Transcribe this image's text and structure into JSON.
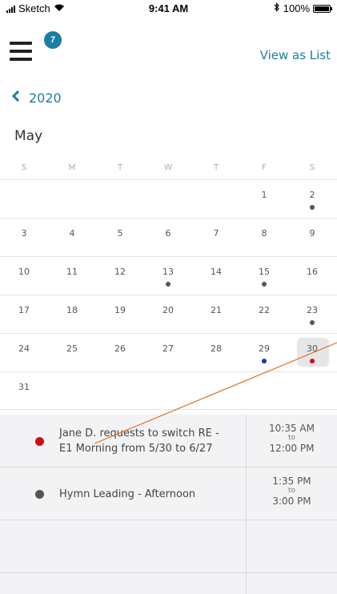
{
  "status_bar": {
    "carrier": "Sketch",
    "time": "9:41 AM",
    "battery": "100%",
    "battery_level": 1.0
  },
  "header": {
    "menu_badge": "7",
    "view_as_list": "View as List"
  },
  "calendar": {
    "year": "2020",
    "month": "May",
    "weekdays": [
      "S",
      "M",
      "T",
      "W",
      "T",
      "F",
      "S"
    ],
    "weeks": [
      [
        {
          "d": ""
        },
        {
          "d": ""
        },
        {
          "d": ""
        },
        {
          "d": ""
        },
        {
          "d": ""
        },
        {
          "d": "1"
        },
        {
          "d": "2",
          "dot": "#555555"
        }
      ],
      [
        {
          "d": "3"
        },
        {
          "d": "4"
        },
        {
          "d": "5"
        },
        {
          "d": "6"
        },
        {
          "d": "7"
        },
        {
          "d": "8"
        },
        {
          "d": "9"
        }
      ],
      [
        {
          "d": "10"
        },
        {
          "d": "11"
        },
        {
          "d": "12"
        },
        {
          "d": "13",
          "dot": "#555555"
        },
        {
          "d": "14"
        },
        {
          "d": "15",
          "dot": "#555555"
        },
        {
          "d": "16"
        }
      ],
      [
        {
          "d": "17"
        },
        {
          "d": "18"
        },
        {
          "d": "19"
        },
        {
          "d": "20"
        },
        {
          "d": "21"
        },
        {
          "d": "22"
        },
        {
          "d": "23",
          "dot": "#555555"
        }
      ],
      [
        {
          "d": "24"
        },
        {
          "d": "25"
        },
        {
          "d": "26"
        },
        {
          "d": "27"
        },
        {
          "d": "28"
        },
        {
          "d": "29",
          "dot": "#1a2fb8"
        },
        {
          "d": "30",
          "dot": "#cc1111",
          "selected": true
        }
      ],
      [
        {
          "d": "31"
        },
        {
          "d": ""
        },
        {
          "d": ""
        },
        {
          "d": ""
        },
        {
          "d": ""
        },
        {
          "d": ""
        },
        {
          "d": ""
        }
      ]
    ]
  },
  "events": [
    {
      "color": "#cc1111",
      "title_line1": "Jane D. requests to switch RE -",
      "title_line2": "E1 Morning from 5/30 to 6/27",
      "start": "10:35 AM",
      "to": "to",
      "end": "12:00 PM"
    },
    {
      "color": "#555555",
      "title_line1": "Hymn Leading - Afternoon",
      "title_line2": "",
      "start": "1:35 PM",
      "to": "to",
      "end": "3:00 PM"
    }
  ],
  "colors": {
    "accent": "#1a7fa0",
    "annotation_line": "#e07020"
  }
}
